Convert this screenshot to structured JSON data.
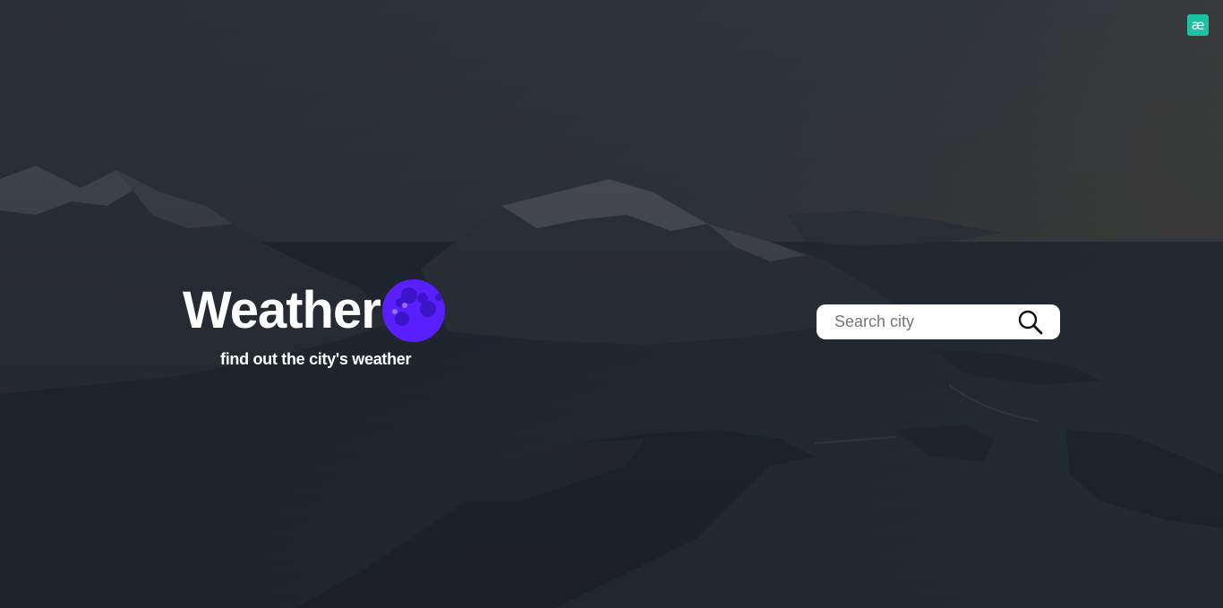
{
  "brand": {
    "title": "Weather",
    "subtitle": "find out the city's weather",
    "moon_color": "#5a1fff",
    "moon_crater_color": "#3d14c8"
  },
  "search": {
    "placeholder": "Search city",
    "value": "",
    "icon": "search-icon"
  },
  "extension_badge": {
    "label": "æ",
    "color": "#1fc1a4"
  },
  "background": {
    "scene": "mountain-fjord-photo",
    "overlay_color": "#1c2028"
  }
}
